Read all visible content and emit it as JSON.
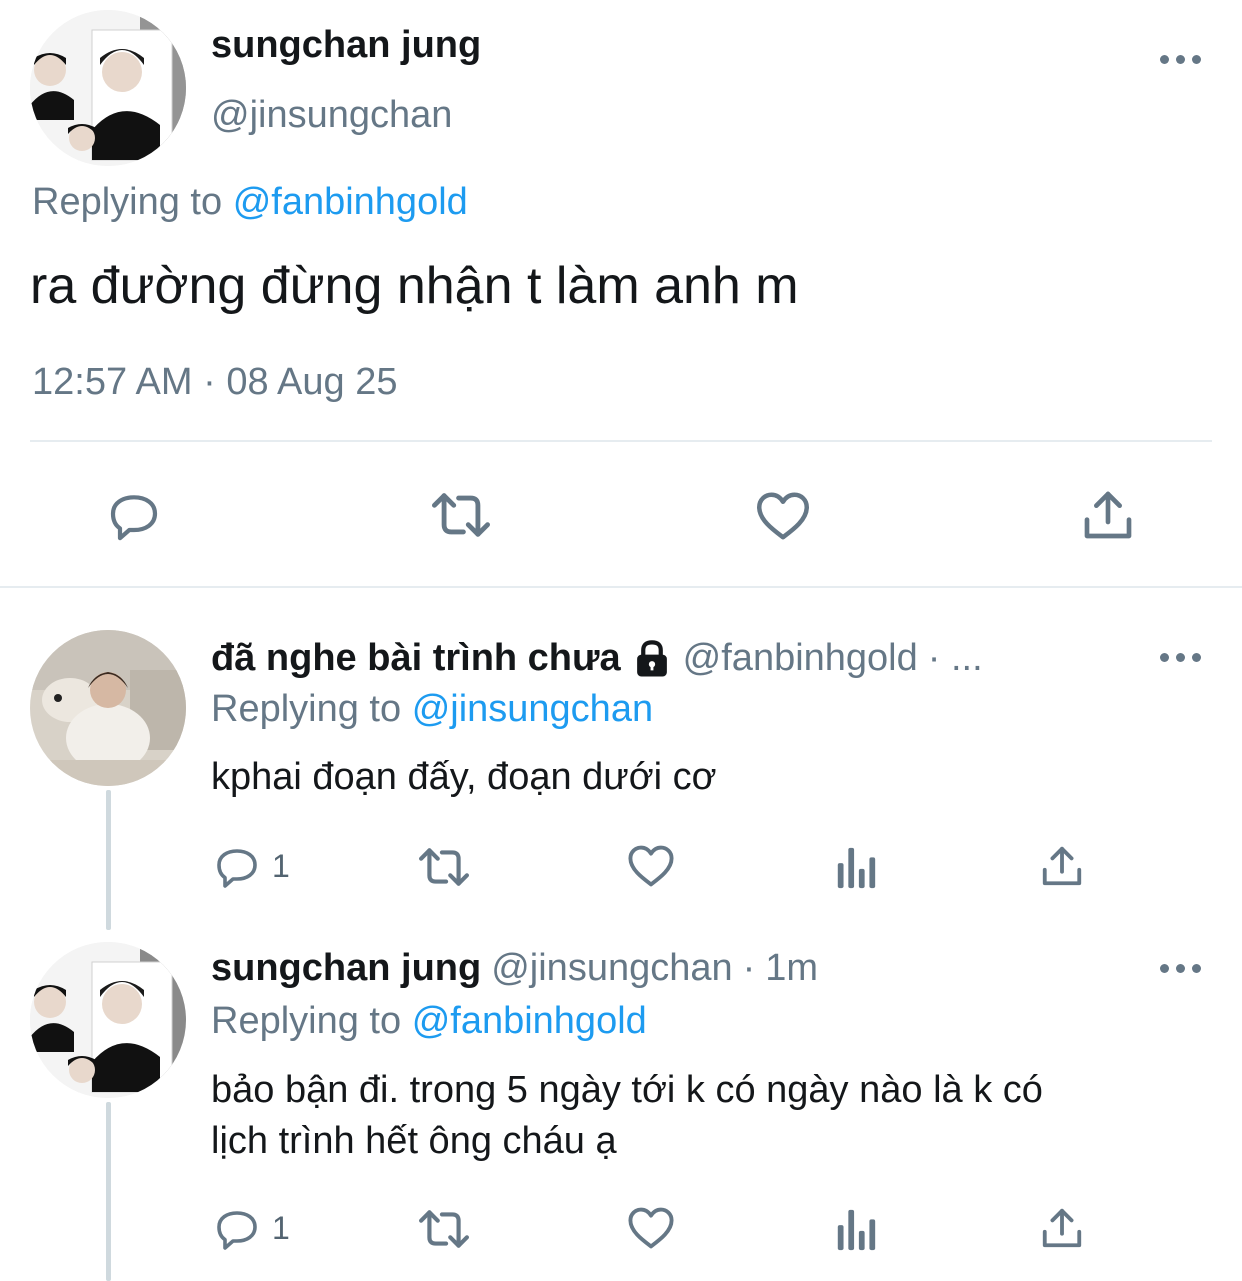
{
  "main_tweet": {
    "display_name": "sungchan jung",
    "handle": "@jinsungchan",
    "replying_prefix": "Replying to",
    "replying_handle": "@fanbinhgold",
    "text": "ra đường đừng nhận t làm anh m",
    "timestamp": "12:57 AM · 08 Aug 25",
    "actions": [
      "reply-icon",
      "retweet-icon",
      "like-icon",
      "share-icon"
    ]
  },
  "replies": [
    {
      "display_name": "đã nghe bài trình chưa",
      "locked": true,
      "handle": "@fanbinhgold",
      "separator": "· ...",
      "replying_prefix": "Replying to",
      "replying_handle": "@jinsungchan",
      "text": "kphai đoạn đấy, đoạn dưới cơ",
      "reply_count": "1",
      "actions": [
        "reply-icon",
        "retweet-icon",
        "like-icon",
        "analytics-icon",
        "share-icon"
      ]
    },
    {
      "display_name": "sungchan jung",
      "handle": "@jinsungchan",
      "separator": "·",
      "time": "1m",
      "replying_prefix": "Replying to",
      "replying_handle": "@fanbinhgold",
      "text_line1": "bảo bận đi. trong 5 ngày tới k có ngày nào là k có",
      "text_line2": "lịch trình hết ông cháu ạ",
      "reply_count": "1",
      "actions": [
        "reply-icon",
        "retweet-icon",
        "like-icon",
        "analytics-icon",
        "share-icon"
      ]
    }
  ],
  "colors": {
    "text": "#14171a",
    "secondary": "#657786",
    "link": "#1d9bf0",
    "divider": "#e6ecf0"
  }
}
